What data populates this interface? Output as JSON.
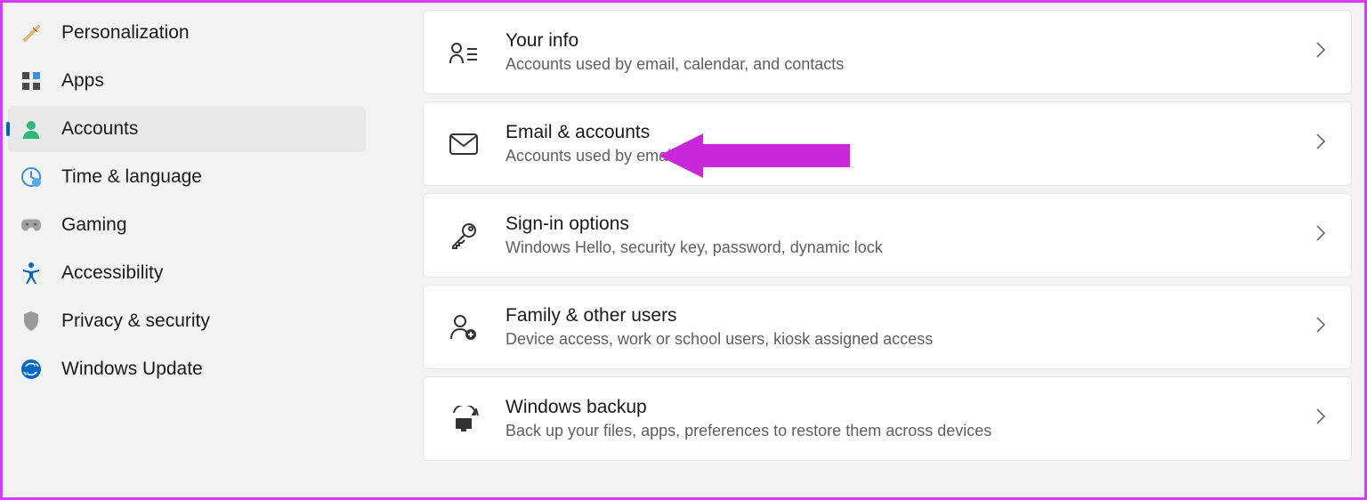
{
  "sidebar": {
    "items": [
      {
        "label": "Personalization",
        "icon": "paintbrush",
        "active": false
      },
      {
        "label": "Apps",
        "icon": "apps-grid",
        "active": false
      },
      {
        "label": "Accounts",
        "icon": "person",
        "active": true
      },
      {
        "label": "Time & language",
        "icon": "clock-globe",
        "active": false
      },
      {
        "label": "Gaming",
        "icon": "gamepad",
        "active": false
      },
      {
        "label": "Accessibility",
        "icon": "accessibility",
        "active": false
      },
      {
        "label": "Privacy & security",
        "icon": "shield",
        "active": false
      },
      {
        "label": "Windows Update",
        "icon": "update-sync",
        "active": false
      }
    ]
  },
  "main": {
    "cards": [
      {
        "title": "Your info",
        "desc": "Accounts used by email, calendar, and contacts",
        "icon": "person-lines"
      },
      {
        "title": "Email & accounts",
        "desc": "Accounts used by email, calendar, and contacts",
        "icon": "envelope"
      },
      {
        "title": "Sign-in options",
        "desc": "Windows Hello, security key, password, dynamic lock",
        "icon": "key"
      },
      {
        "title": "Family & other users",
        "desc": "Device access, work or school users, kiosk assigned access",
        "icon": "people-add"
      },
      {
        "title": "Windows backup",
        "desc": "Back up your files, apps, preferences to restore them across devices",
        "icon": "backup-sync"
      }
    ]
  }
}
